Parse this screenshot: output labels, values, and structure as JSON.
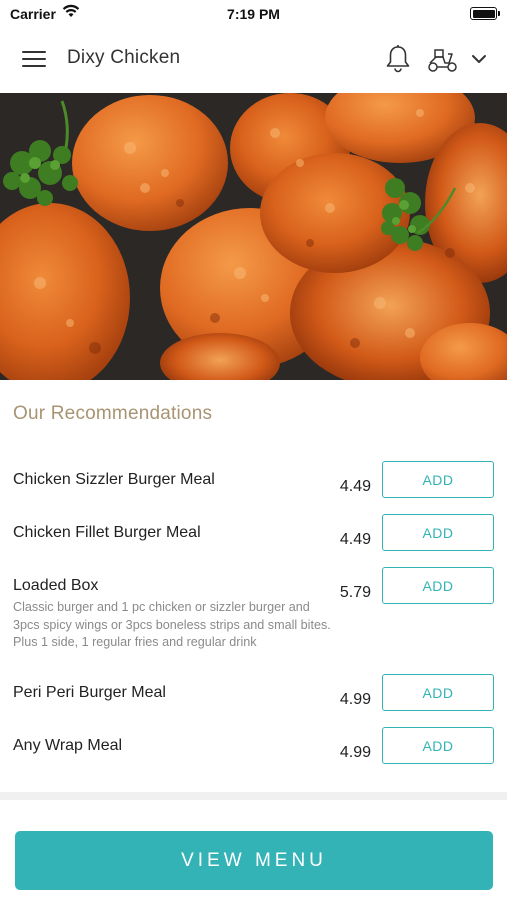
{
  "status_bar": {
    "carrier": "Carrier",
    "time": "7:19 PM",
    "wifi_icon": "wifi-icon",
    "battery_icon": "battery-icon"
  },
  "nav": {
    "title": "Dixy Chicken",
    "menu_icon": "hamburger-menu-icon",
    "notification_icon": "bell-icon",
    "delivery_icon": "scooter-icon",
    "dropdown_icon": "chevron-down-icon"
  },
  "hero": {
    "image": "fried-chicken-photo"
  },
  "recommendations": {
    "title": "Our Recommendations",
    "items": [
      {
        "name": "Chicken Sizzler Burger Meal",
        "description": "",
        "price": "4.49",
        "add_label": "ADD"
      },
      {
        "name": "Chicken Fillet Burger Meal",
        "description": "",
        "price": "4.49",
        "add_label": "ADD"
      },
      {
        "name": "Loaded Box",
        "description": "Classic burger and 1 pc chicken or sizzler burger and 3pcs spicy wings or 3pcs boneless strips and small bites. Plus 1 side, 1 regular fries and regular drink",
        "price": "5.79",
        "add_label": "ADD"
      },
      {
        "name": "Peri Peri Burger Meal",
        "description": "",
        "price": "4.99",
        "add_label": "ADD"
      },
      {
        "name": "Any Wrap Meal",
        "description": "",
        "price": "4.99",
        "add_label": "ADD"
      }
    ]
  },
  "footer": {
    "view_menu_label": "VIEW MENU"
  },
  "colors": {
    "accent": "#33b3b6",
    "section_title": "#a89472",
    "description": "#8a8a8a"
  }
}
